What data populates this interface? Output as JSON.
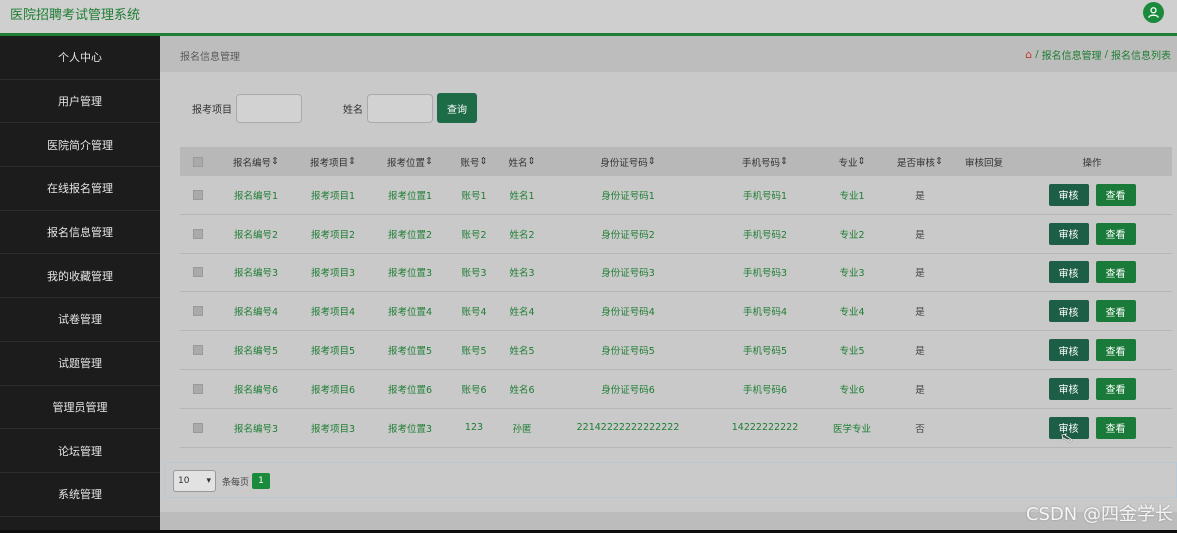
{
  "app": {
    "title": "医院招聘考试管理系统",
    "user_icon": "user-icon"
  },
  "sidebar": {
    "items": [
      {
        "label": "个人中心"
      },
      {
        "label": "用户管理"
      },
      {
        "label": "医院简介管理"
      },
      {
        "label": "在线报名管理"
      },
      {
        "label": "报名信息管理"
      },
      {
        "label": "我的收藏管理"
      },
      {
        "label": "试卷管理"
      },
      {
        "label": "试题管理"
      },
      {
        "label": "管理员管理"
      },
      {
        "label": "论坛管理"
      },
      {
        "label": "系统管理"
      }
    ]
  },
  "header": {
    "page_title": "报名信息管理",
    "breadcrumb": {
      "sep1": "/",
      "item1": "报名信息管理",
      "sep2": "/",
      "item2": "报名信息列表"
    }
  },
  "search": {
    "label_project": "报考项目",
    "label_name": "姓名",
    "button": "查询"
  },
  "table": {
    "headers": [
      "报名编号",
      "报考项目",
      "报考位置",
      "账号",
      "姓名",
      "身份证号码",
      "手机号码",
      "专业",
      "是否审核",
      "审核回复",
      "操作"
    ],
    "rows": [
      {
        "c0": "报名编号1",
        "c1": "报考项目1",
        "c2": "报考位置1",
        "c3": "账号1",
        "c4": "姓名1",
        "c5": "身份证号码1",
        "c6": "手机号码1",
        "c7": "专业1",
        "c8": "是",
        "c9": ""
      },
      {
        "c0": "报名编号2",
        "c1": "报考项目2",
        "c2": "报考位置2",
        "c3": "账号2",
        "c4": "姓名2",
        "c5": "身份证号码2",
        "c6": "手机号码2",
        "c7": "专业2",
        "c8": "是",
        "c9": ""
      },
      {
        "c0": "报名编号3",
        "c1": "报考项目3",
        "c2": "报考位置3",
        "c3": "账号3",
        "c4": "姓名3",
        "c5": "身份证号码3",
        "c6": "手机号码3",
        "c7": "专业3",
        "c8": "是",
        "c9": ""
      },
      {
        "c0": "报名编号4",
        "c1": "报考项目4",
        "c2": "报考位置4",
        "c3": "账号4",
        "c4": "姓名4",
        "c5": "身份证号码4",
        "c6": "手机号码4",
        "c7": "专业4",
        "c8": "是",
        "c9": ""
      },
      {
        "c0": "报名编号5",
        "c1": "报考项目5",
        "c2": "报考位置5",
        "c3": "账号5",
        "c4": "姓名5",
        "c5": "身份证号码5",
        "c6": "手机号码5",
        "c7": "专业5",
        "c8": "是",
        "c9": ""
      },
      {
        "c0": "报名编号6",
        "c1": "报考项目6",
        "c2": "报考位置6",
        "c3": "账号6",
        "c4": "姓名6",
        "c5": "身份证号码6",
        "c6": "手机号码6",
        "c7": "专业6",
        "c8": "是",
        "c9": ""
      },
      {
        "c0": "报名编号3",
        "c1": "报考项目3",
        "c2": "报考位置3",
        "c3": "123",
        "c4": "孙匿",
        "c5": "22142222222222222",
        "c6": "14222222222",
        "c7": "医学专业",
        "c8": "否",
        "c9": ""
      }
    ],
    "actions": {
      "audit": "审核",
      "view": "查看"
    }
  },
  "pagination": {
    "page_size": "10",
    "per_page_label": "条每页",
    "current_page": "1"
  },
  "watermark": "CSDN @四金学长",
  "colors": {
    "accent": "#1e7e34",
    "sidebar_bg": "#1c1c1c",
    "button_dark": "#1d5e47"
  }
}
